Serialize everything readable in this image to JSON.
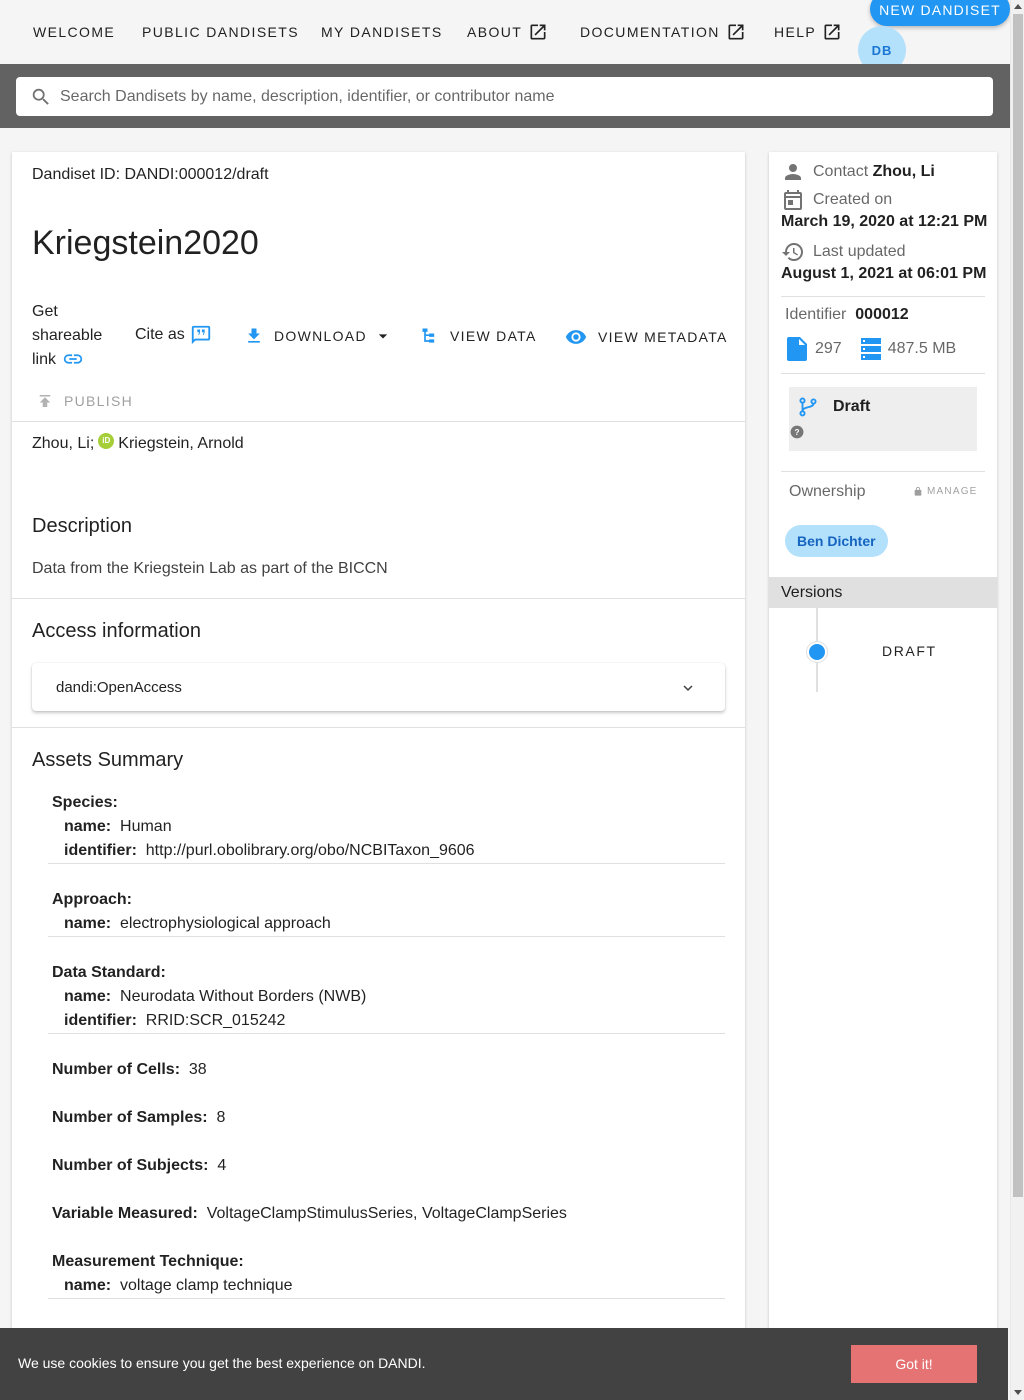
{
  "nav": {
    "items": [
      "WELCOME",
      "PUBLIC DANDISETS",
      "MY DANDISETS",
      "ABOUT",
      "DOCUMENTATION",
      "HELP"
    ],
    "new_dandiset": "NEW DANDISET",
    "avatar_initials": "DB"
  },
  "search": {
    "placeholder": "Search Dandisets by name, description, identifier, or contributor name"
  },
  "dandiset": {
    "id_line": "Dandiset ID: DANDI:000012/draft",
    "title": "Kriegstein2020",
    "share_link": "Get shareable link",
    "cite_as": "Cite as",
    "download": "DOWNLOAD",
    "view_data": "VIEW DATA",
    "view_metadata": "VIEW METADATA",
    "publish": "PUBLISH",
    "contributor_1": "Zhou, Li;",
    "contributor_2": "Kriegstein, Arnold",
    "orcid_badge": "iD",
    "description_title": "Description",
    "description": "Data from the Kriegstein Lab as part of the BICCN",
    "access_title": "Access information",
    "access_value": "dandi:OpenAccess",
    "assets_title": "Assets Summary"
  },
  "assets": {
    "species_key": "Species:",
    "species_name_key": "name:",
    "species_name": "Human",
    "species_id_key": "identifier:",
    "species_id": "http://purl.obolibrary.org/obo/NCBITaxon_9606",
    "approach_key": "Approach:",
    "approach_name_key": "name:",
    "approach_name": "electrophysiological approach",
    "standard_key": "Data Standard:",
    "standard_name_key": "name:",
    "standard_name": "Neurodata Without Borders (NWB)",
    "standard_id_key": "identifier:",
    "standard_id": "RRID:SCR_015242",
    "cells_key": "Number of Cells:",
    "cells": "38",
    "samples_key": "Number of Samples:",
    "samples": "8",
    "subjects_key": "Number of Subjects:",
    "subjects": "4",
    "variable_key": "Variable Measured:",
    "variable": "VoltageClampStimulusSeries, VoltageClampSeries",
    "technique_key": "Measurement Technique:",
    "technique_name_key": "name:",
    "technique_name": "voltage clamp technique"
  },
  "side": {
    "contact_label": "Contact",
    "contact_value": "Zhou, Li",
    "created_label": "Created on",
    "created_value": "March 19, 2020 at 12:21 PM",
    "updated_label": "Last updated",
    "updated_value": "August 1, 2021 at 06:01 PM",
    "identifier_label": "Identifier",
    "identifier_value": "000012",
    "file_count": "297",
    "size": "487.5 MB",
    "draft_label": "Draft",
    "ownership_label": "Ownership",
    "manage": "MANAGE",
    "owner": "Ben Dichter",
    "versions_label": "Versions",
    "version_item": "DRAFT"
  },
  "cookie": {
    "text": "We use cookies to ensure you get the best experience on DANDI.",
    "button": "Got it!"
  },
  "colors": {
    "accent": "#2196f3",
    "chip_bg": "#b3e0fb",
    "cookie_btn": "#e57373",
    "searchbar_bg": "#626262"
  }
}
